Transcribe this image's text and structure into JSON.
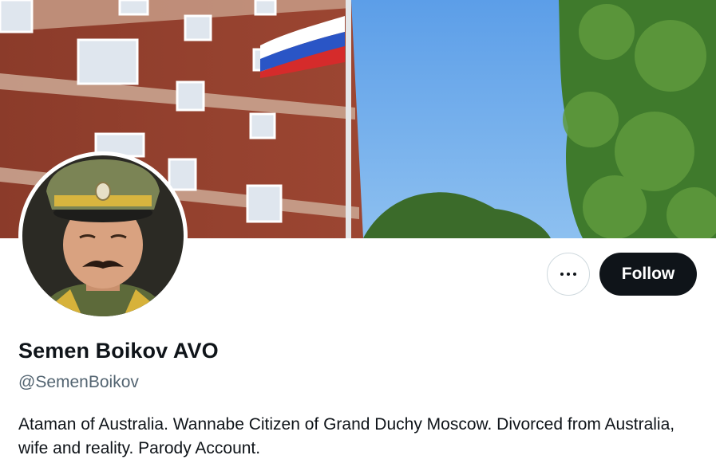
{
  "profile": {
    "display_name": "Semen Boikov AVO",
    "handle": "@SemenBoikov",
    "bio": "Ataman of Australia. Wannabe Citizen of Grand Duchy Moscow. Divorced from Australia, wife and reality. Parody Account."
  },
  "actions": {
    "follow_label": "Follow",
    "more_icon": "more-dots-icon"
  },
  "colors": {
    "primary_text": "#0f1419",
    "secondary_text": "#536471",
    "follow_bg": "#0f1419",
    "border": "#cfd9de"
  }
}
